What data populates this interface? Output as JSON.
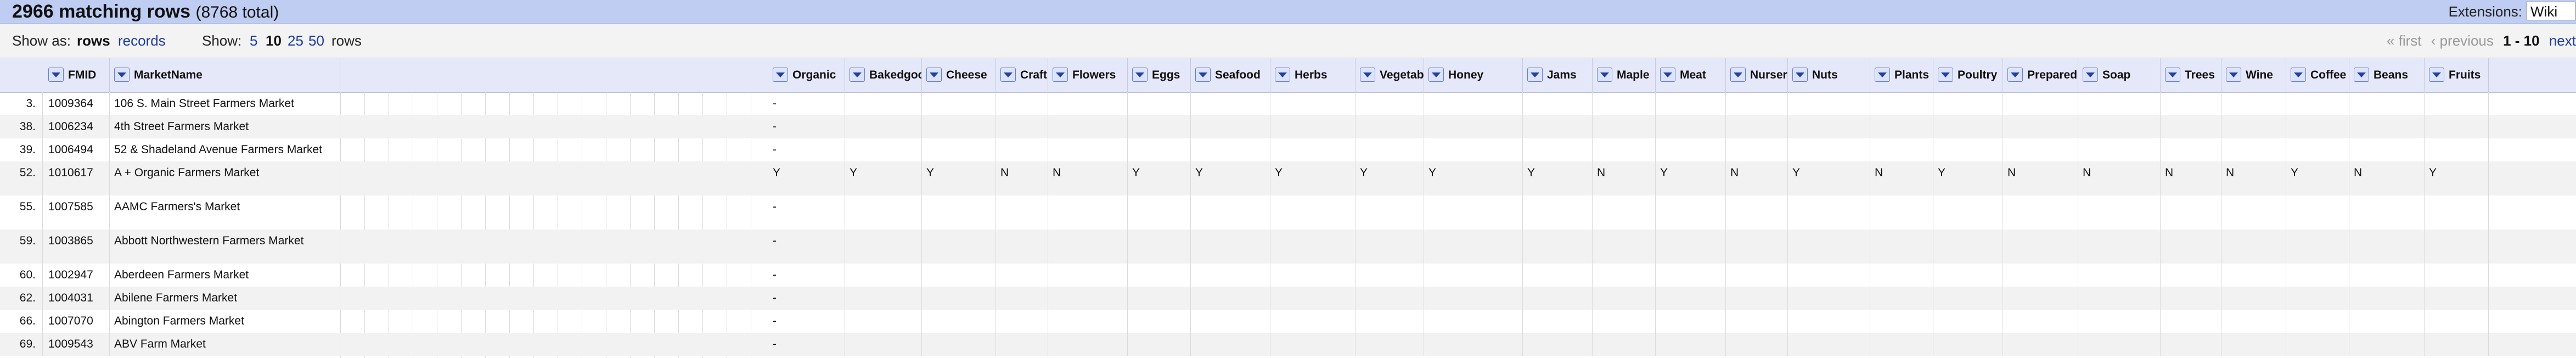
{
  "header": {
    "count_text": "2966 matching rows",
    "total_text": "(8768 total)",
    "extensions_label": "Extensions:",
    "extensions_value": "Wiki"
  },
  "view": {
    "show_as_label": "Show as:",
    "show_as_rows": "rows",
    "show_as_records": "records",
    "show_label": "Show:",
    "page_sizes": [
      "5",
      "10",
      "25",
      "50"
    ],
    "page_size_selected": "10",
    "rows_label": "rows",
    "pager": {
      "first": "« first",
      "previous": "‹ previous",
      "range": "1 - 10",
      "next": "next"
    }
  },
  "columns": [
    "FMID",
    "MarketName",
    "Organic",
    "Bakedgoods",
    "Cheese",
    "Crafts",
    "Flowers",
    "Eggs",
    "Seafood",
    "Herbs",
    "Vegetables",
    "Honey",
    "Jams",
    "Maple",
    "Meat",
    "Nursery",
    "Nuts",
    "Plants",
    "Poultry",
    "Prepared",
    "Soap",
    "Trees",
    "Wine",
    "Coffee",
    "Beans",
    "Fruits"
  ],
  "rows": [
    {
      "num": "3.",
      "fmid": "1009364",
      "name": "106 S. Main Street Farmers Market",
      "vals": [
        "-"
      ]
    },
    {
      "num": "38.",
      "fmid": "1006234",
      "name": "4th Street Farmers Market",
      "vals": [
        "-"
      ]
    },
    {
      "num": "39.",
      "fmid": "1006494",
      "name": "52 & Shadeland Avenue Farmers Market",
      "vals": [
        "-"
      ]
    },
    {
      "num": "52.",
      "fmid": "1010617",
      "name": "A + Organic Farmers Market",
      "vals": [
        "Y",
        "Y",
        "Y",
        "N",
        "N",
        "Y",
        "Y",
        "Y",
        "Y",
        "Y",
        "Y",
        "N",
        "Y",
        "N",
        "Y",
        "N",
        "Y",
        "N",
        "N",
        "N",
        "N",
        "Y",
        "N",
        "Y"
      ]
    },
    {
      "num": "55.",
      "fmid": "1007585",
      "name": "AAMC Farmers's Market",
      "vals": [
        "-"
      ]
    },
    {
      "num": "59.",
      "fmid": "1003865",
      "name": "Abbott Northwestern Farmers Market",
      "vals": [
        "-"
      ]
    },
    {
      "num": "60.",
      "fmid": "1002947",
      "name": "Aberdeen Farmers Market",
      "vals": [
        "-"
      ]
    },
    {
      "num": "62.",
      "fmid": "1004031",
      "name": "Abilene Farmers Market",
      "vals": [
        "-"
      ]
    },
    {
      "num": "66.",
      "fmid": "1007070",
      "name": "Abington Farmers Market",
      "vals": [
        "-"
      ]
    },
    {
      "num": "69.",
      "fmid": "1009543",
      "name": "ABV Farm Market",
      "vals": [
        "-"
      ]
    }
  ]
}
